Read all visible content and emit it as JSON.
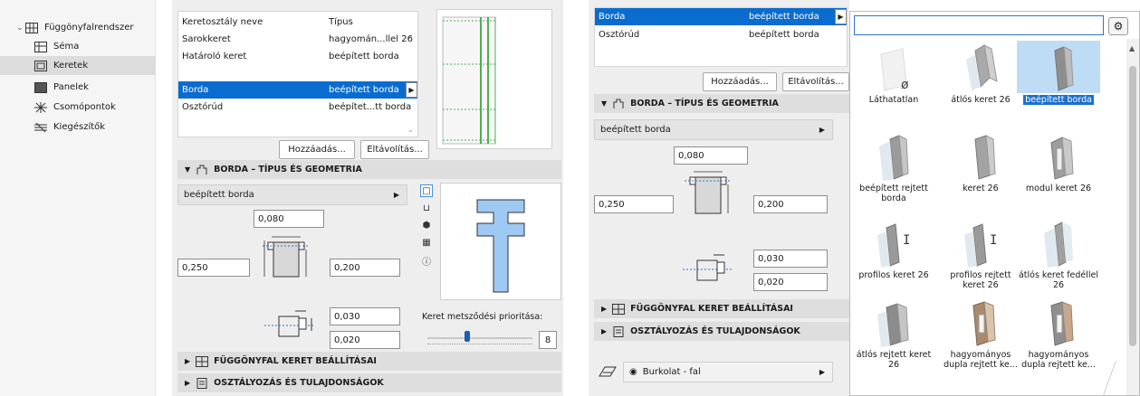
{
  "tree": {
    "root": "Függönyfalrendszer",
    "items": [
      {
        "label": "Séma",
        "icon": "schema-icon",
        "selected": false
      },
      {
        "label": "Keretek",
        "icon": "frame-icon",
        "selected": true
      },
      {
        "label": "Panelek",
        "icon": "panel-icon",
        "selected": false
      },
      {
        "label": "Csomópontok",
        "icon": "junction-icon",
        "selected": false
      },
      {
        "label": "Kiegészítők",
        "icon": "accessory-icon",
        "selected": false
      }
    ]
  },
  "panel1": {
    "list_header": {
      "col1": "Keretosztály neve",
      "col2": "Típus"
    },
    "list_rows": [
      {
        "name": "Sarokkeret",
        "type": "hagyomán...llel 26"
      },
      {
        "name": "Határoló keret",
        "type": "beépített borda"
      },
      {
        "name": "Borda",
        "type": "beépített borda",
        "selected": true
      },
      {
        "name": "Osztórúd",
        "type": "beépítet...tt borda"
      }
    ],
    "add_button": "Hozzáadás...",
    "remove_button": "Eltávolítás...",
    "section_geometry": "BORDA – TÍPUS ÉS GEOMETRIA",
    "type_dropdown": "beépített borda",
    "dims": {
      "top": "0,080",
      "left": "0,250",
      "right": "0,200",
      "offset1": "0,030",
      "offset2": "0,020"
    },
    "priority_label": "Keret metsződési prioritása:",
    "priority_value": "8",
    "priority_fraction": 0.35,
    "section_settings": "FÜGGÖNYFAL KERET BEÁLLÍTÁSAI",
    "section_classification": "OSZTÁLYOZÁS ÉS TULAJDONSÁGOK"
  },
  "panel2": {
    "list_rows": [
      {
        "name": "Borda",
        "type": "beépített borda",
        "selected": true
      },
      {
        "name": "Osztórúd",
        "type": "beépített borda"
      }
    ],
    "add_button": "Hozzáadás...",
    "remove_button": "Eltávolítás...",
    "section_geometry": "BORDA – TÍPUS ÉS GEOMETRIA",
    "type_dropdown": "beépített borda",
    "dims": {
      "top": "0,080",
      "left": "0,250",
      "right": "0,200",
      "offset1": "0,030",
      "offset2": "0,020"
    },
    "section_settings": "FÜGGÖNYFAL KERET BEÁLLÍTÁSAI",
    "section_classification": "OSZTÁLYOZÁS ÉS TULAJDONSÁGOK",
    "surface_dropdown": "Burkolat - fal"
  },
  "popup": {
    "search_value": "",
    "tiles": [
      {
        "label": "Láthatatlan",
        "selected": false
      },
      {
        "label": "átlós keret 26",
        "selected": false
      },
      {
        "label": "beépített borda",
        "selected": true
      },
      {
        "label": "beépített rejtett borda",
        "selected": false
      },
      {
        "label": "keret 26",
        "selected": false
      },
      {
        "label": "modul keret 26",
        "selected": false
      },
      {
        "label": "profilos keret 26",
        "selected": false
      },
      {
        "label": "profilos rejtett keret 26",
        "selected": false
      },
      {
        "label": "átlós keret fedéllel 26",
        "selected": false
      },
      {
        "label": "átlós rejtett keret 26",
        "selected": false
      },
      {
        "label": "hagyományos dupla rejtett ke...",
        "selected": false
      },
      {
        "label": "hagyományos dupla rejtett ke...",
        "selected": false
      }
    ]
  },
  "colors": {
    "selection": "#0b6ccf",
    "tile_selection": "#bfdcf5",
    "preview_fill": "#9ec9f2"
  }
}
